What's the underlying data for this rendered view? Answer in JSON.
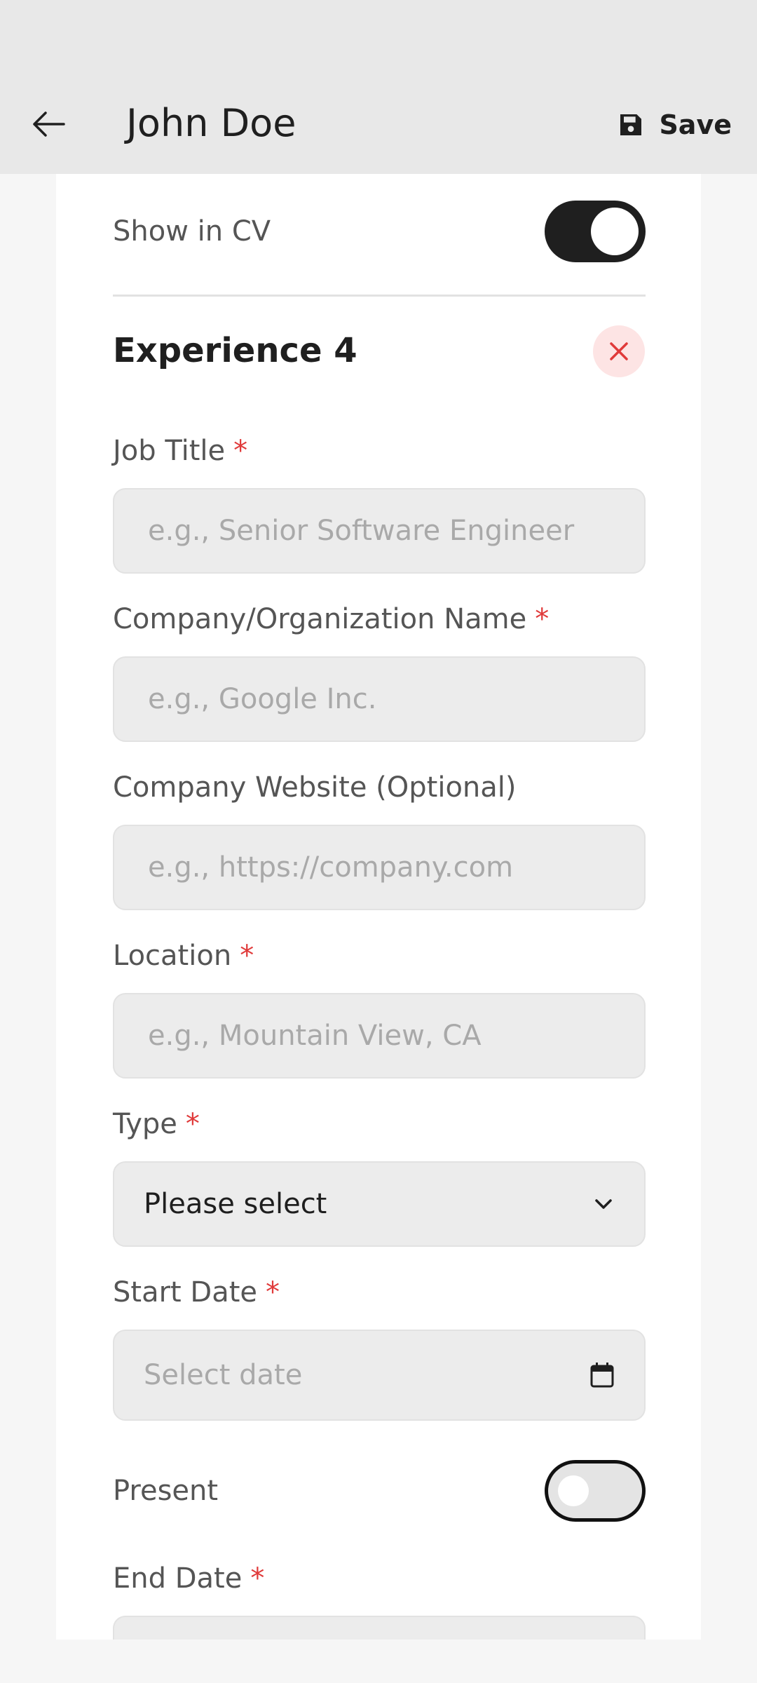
{
  "header": {
    "title": "John Doe",
    "save_label": "Save",
    "back_icon": "arrow-left-icon",
    "save_icon": "floppy-disk-icon"
  },
  "form": {
    "show_in_cv": {
      "label": "Show in CV",
      "on": true
    },
    "section_title": "Experience 4",
    "required_mark": "*",
    "job_title": {
      "label": "Job Title",
      "placeholder": "e.g., Senior Software Engineer",
      "value": ""
    },
    "company": {
      "label": "Company/Organization Name",
      "placeholder": "e.g., Google Inc.",
      "value": ""
    },
    "website": {
      "label": "Company Website (Optional)",
      "placeholder": "e.g., https://company.com",
      "value": ""
    },
    "location": {
      "label": "Location",
      "placeholder": "e.g., Mountain View, CA",
      "value": ""
    },
    "type": {
      "label": "Type",
      "selected": "Please select"
    },
    "start_date": {
      "label": "Start Date",
      "placeholder": "Select date"
    },
    "present": {
      "label": "Present",
      "on": false
    },
    "end_date": {
      "label": "End Date"
    }
  },
  "colors": {
    "appbar_bg": "#e8e8e8",
    "card_bg": "#ffffff",
    "required": "#e03a3a",
    "remove_bg": "#fde4e4",
    "toggle_on": "#1f1f1f"
  }
}
